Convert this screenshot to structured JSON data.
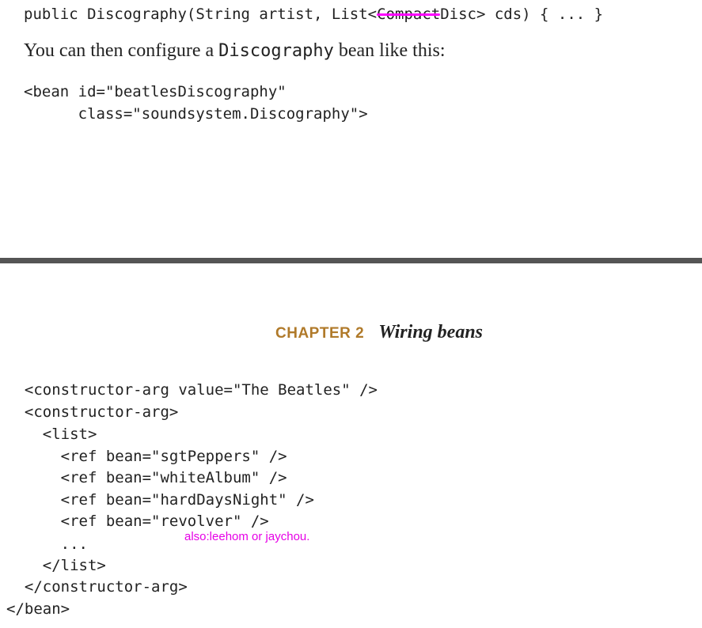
{
  "top": {
    "signature_prefix": "public Discography(String artist, List<",
    "signature_strike": "Compact",
    "signature_suffix": "Disc> cds) { ... }",
    "prose_before": "You can then configure a ",
    "prose_code": "Discography",
    "prose_after": " bean like this:",
    "code": [
      "<bean id=\"beatlesDiscography\"",
      "      class=\"soundsystem.Discography\">"
    ]
  },
  "header": {
    "chapter": "CHAPTER 2",
    "title": "Wiring beans"
  },
  "bottom": {
    "code": [
      "  <constructor-arg value=\"The Beatles\" />",
      "  <constructor-arg>",
      "    <list>",
      "      <ref bean=\"sgtPeppers\" />",
      "      <ref bean=\"whiteAlbum\" />",
      "      <ref bean=\"hardDaysNight\" />",
      "      <ref bean=\"revolver\" />",
      "      ...",
      "    </list>",
      "  </constructor-arg>",
      "</bean>"
    ],
    "annotation": "also:leehom or jaychou."
  },
  "colors": {
    "strike": "#ff00ff",
    "chapter_label": "#b07a2a",
    "annotation": "#e600e6",
    "divider": "#555555"
  }
}
